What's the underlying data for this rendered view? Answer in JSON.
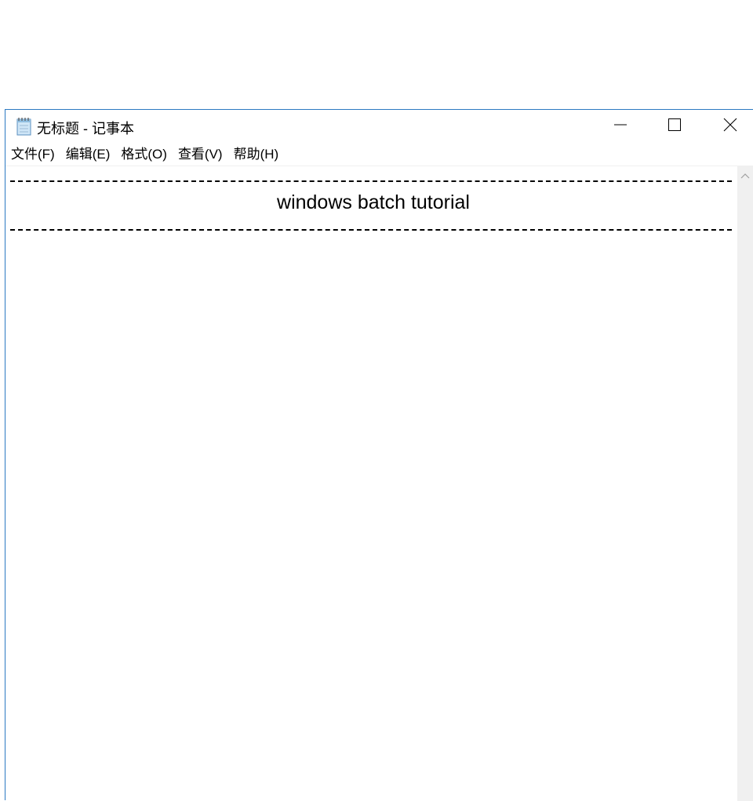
{
  "window": {
    "title": "无标题 - 记事本",
    "accent_color": "#2b79c2"
  },
  "caption_buttons": {
    "minimize_icon": "minimize-icon",
    "maximize_icon": "maximize-icon",
    "close_icon": "close-icon"
  },
  "menu": {
    "items": [
      {
        "label": "文件(F)"
      },
      {
        "label": "编辑(E)"
      },
      {
        "label": "格式(O)"
      },
      {
        "label": "查看(V)"
      },
      {
        "label": "帮助(H)"
      }
    ]
  },
  "editor": {
    "title_line": "windows batch tutorial"
  }
}
